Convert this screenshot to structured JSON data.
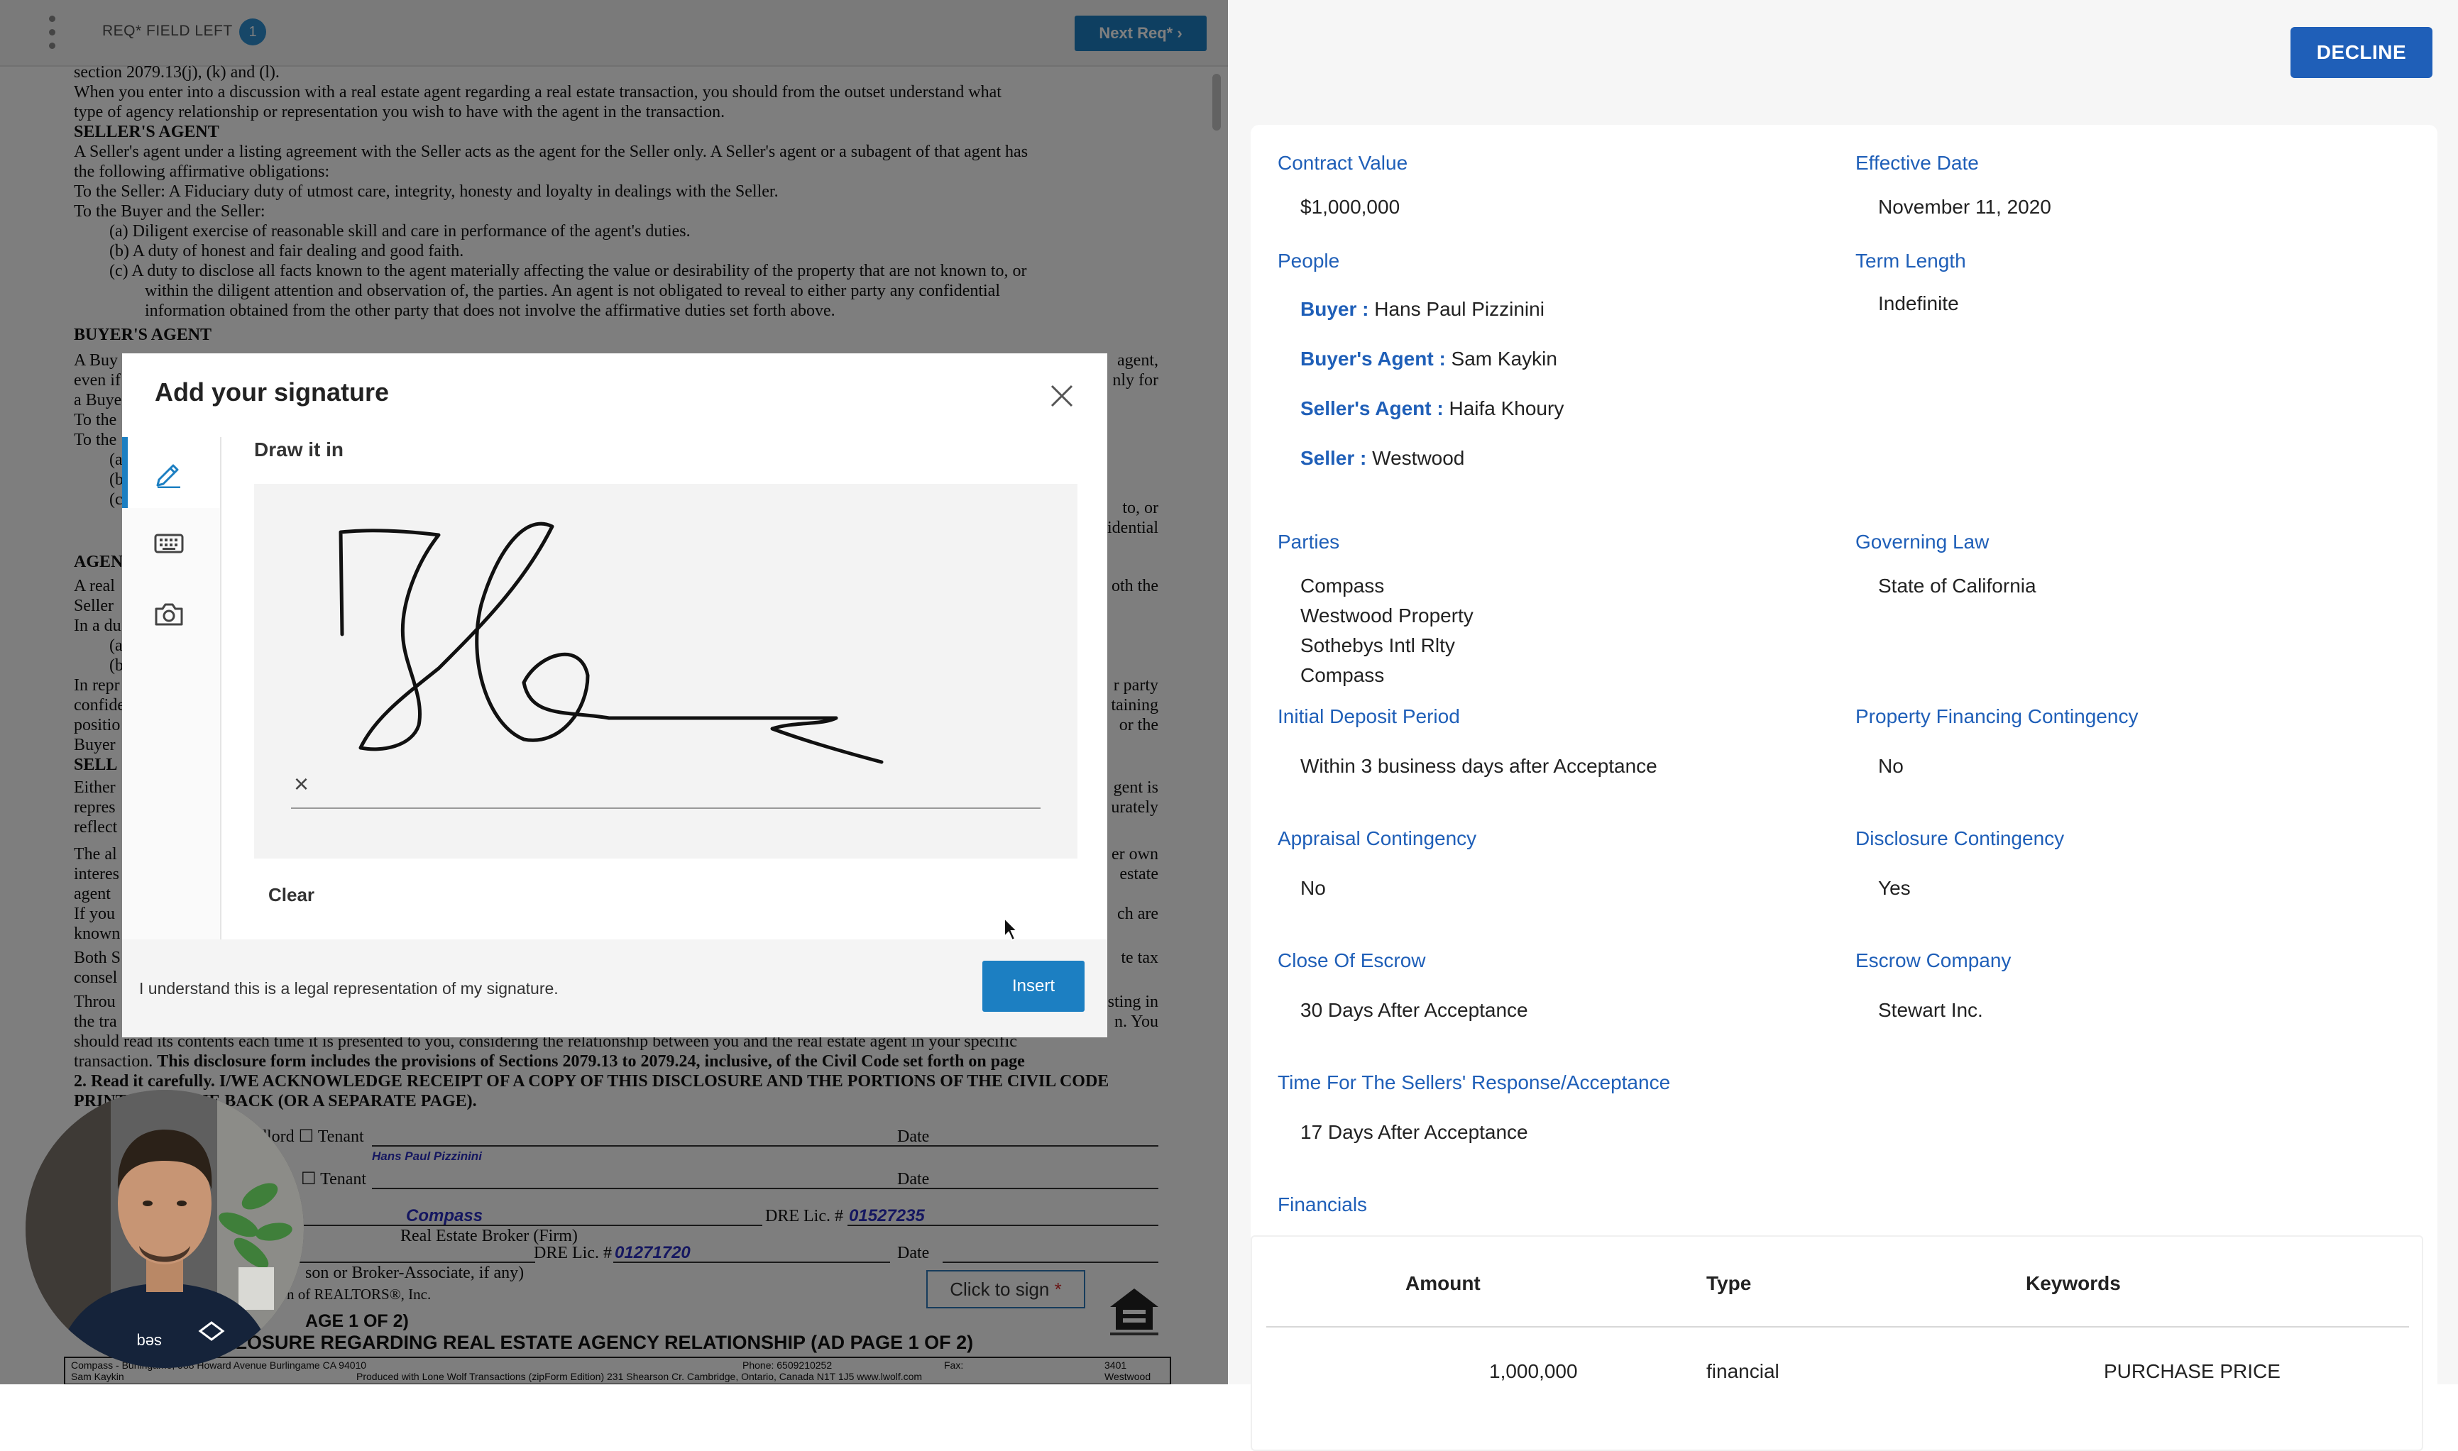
{
  "doc_toolbar": {
    "req_label": "REQ* FIELD LEFT",
    "req_count": "1",
    "next_req_label": "Next Req*",
    "next_req_icon": "chevron-right-icon"
  },
  "document": {
    "lines": {
      "l1": "section 2079.13(j), (k) and (l).",
      "l2": "When you enter into a discussion with a real estate agent regarding a real estate transaction, you should from the outset understand what",
      "l3": "type of agency relationship or representation you wish to have with the agent in the transaction.",
      "h_seller": "SELLER'S AGENT",
      "l4": "A Seller's agent under a listing agreement with the Seller acts as the agent for the Seller only. A Seller's agent or a subagent of that agent has",
      "l5": "the following affirmative obligations:",
      "l6": "To the Seller: A Fiduciary duty of utmost care, integrity, honesty and loyalty in dealings with the Seller.",
      "l7": "To the Buyer and the Seller:",
      "a": "(a)    Diligent exercise of reasonable skill and care in performance of the agent's duties.",
      "b": "(b)    A duty of honest and fair dealing and good faith.",
      "c1": "(c)    A duty to disclose all facts known to the agent materially affecting the value or desirability of the property that are not known to, or",
      "c2": "within the diligent attention and observation of, the parties. An agent is not obligated to reveal to either party any confidential",
      "c3": "information obtained from the other party that does not involve the affirmative duties set forth above.",
      "h_buyer": "BUYER'S AGENT",
      "b1": "A Buy",
      "b1r": "agent,",
      "b2": "even if",
      "b2r": "nly for",
      "b3": "a Buye",
      "b4": "To the",
      "b5": "To the",
      "b6": "(a",
      "b7": "(b",
      "b7r": "to, or",
      "b8": "(c",
      "b8r": "idential",
      "h_agent": "AGEN",
      "g1": "A real",
      "g1r": "oth the",
      "g2": "Seller",
      "g3": "In a du",
      "g4": "(a",
      "g5": "(b",
      "r1": "In repr",
      "r1r": "r party",
      "r2": "confide",
      "r2r": "taining",
      "r3": "positio",
      "r3r": "or the",
      "r4": "Buyer",
      "h_sell": "SELL",
      "s1": "Either",
      "s1r": "gent is",
      "s2": "repres",
      "s2r": "urately",
      "s3": "reflect",
      "t1": "The al",
      "t1r": "er own",
      "t2": "interes",
      "t2r": "estate",
      "t3": "agent",
      "u1": "If you",
      "u1r": "ch are",
      "u2": "known",
      "v1": "Both S",
      "v1r": "te tax",
      "v2": "consel",
      "w1": "Throu",
      "w1r": "sting in",
      "w2": "the tra",
      "w2r": "n. You",
      "w3": "should read its contents each time it is presented to you, considering the relationship between you and the real estate agent in your specific",
      "w4": "transaction.",
      "w4b": "This disclosure form includes the provisions of Sections 2079.13 to 2079.24, inclusive, of the Civil Code set forth on page",
      "w5": "2. Read it carefully. I/WE ACKNOWLEDGE RECEIPT OF A COPY OF THIS DISCLOSURE AND THE PORTIONS OF THE CIVIL CODE",
      "w6": "PRINTED ON THE BACK (OR A SEPARATE PAGE)."
    },
    "sign": {
      "landlord_frag": "dlord",
      "tenant_label": "Tenant",
      "date_label": "Date",
      "buyer_sig": "Hans Paul Pizzinini",
      "firm_name": "Compass",
      "dre_label": "DRE Lic. #",
      "dre_1": "01527235",
      "firm_caption": "Real Estate Broker (Firm)",
      "dre_2": "01271720",
      "assoc_caption": "son or Broker-Associate, if any)",
      "realtors_caption": "n of REALTORS®, Inc.",
      "page_caption": "AGE 1 OF 2)",
      "page_title": "CLOSURE REGARDING REAL ESTATE AGENCY RELATIONSHIP (AD PAGE 1 OF 2)",
      "click_to_sign": "Click to sign",
      "req_star": "*"
    },
    "footer": {
      "left": "Compass - Burlingame, 988 Howard Avenue Burlingame CA 94010",
      "phone": "Phone: 6509210252",
      "fax": "Fax:",
      "right": "3401 Westwood",
      "name": "Sam Kaykin",
      "produced": "Produced with Lone Wolf Transactions (zipForm Edition) 231 Shearson Cr. Cambridge, Ontario, Canada N1T 1J5   www.lwolf.com"
    }
  },
  "modal": {
    "title": "Add your signature",
    "close_icon": "close-icon",
    "tabs": [
      {
        "icon": "pen-icon",
        "active": true
      },
      {
        "icon": "keyboard-icon",
        "active": false
      },
      {
        "icon": "camera-icon",
        "active": false
      }
    ],
    "draw_label": "Draw it in",
    "baseline_mark": "×",
    "clear_label": "Clear",
    "legal_text": "I understand this is a legal representation of my signature.",
    "insert_label": "Insert"
  },
  "details": {
    "decline_label": "DECLINE",
    "contract_value": {
      "label": "Contract Value",
      "value": "$1,000,000"
    },
    "effective_date": {
      "label": "Effective Date",
      "value": "November 11, 2020"
    },
    "people": {
      "label": "People",
      "items": [
        {
          "role": "Buyer :",
          "name": " Hans Paul Pizzinini"
        },
        {
          "role": "Buyer's Agent :",
          "name": " Sam Kaykin"
        },
        {
          "role": "Seller's Agent :",
          "name": " Haifa Khoury"
        },
        {
          "role": "Seller :",
          "name": " Westwood"
        }
      ]
    },
    "term_length": {
      "label": "Term Length",
      "value": "Indefinite"
    },
    "parties": {
      "label": "Parties",
      "values": [
        "Compass",
        "Westwood Property",
        "Sothebys Intl Rlty",
        "Compass"
      ]
    },
    "governing_law": {
      "label": "Governing Law",
      "value": "State of California"
    },
    "initial_deposit": {
      "label": "Initial Deposit Period",
      "value": "Within 3 business days after Acceptance"
    },
    "financing_contingency": {
      "label": "Property Financing Contingency",
      "value": "No"
    },
    "appraisal_contingency": {
      "label": "Appraisal Contingency",
      "value": "No"
    },
    "disclosure_contingency": {
      "label": "Disclosure Contingency",
      "value": "Yes"
    },
    "close_of_escrow": {
      "label": "Close Of Escrow",
      "value": "30 Days After Acceptance"
    },
    "escrow_company": {
      "label": "Escrow Company",
      "value": "Stewart Inc."
    },
    "response_time": {
      "label": "Time For The Sellers' Response/Acceptance",
      "value": "17 Days After Acceptance"
    },
    "financials": {
      "label": "Financials",
      "columns": [
        "Amount",
        "Type",
        "Keywords"
      ],
      "rows": [
        {
          "amount": "1,000,000",
          "type": "financial",
          "keywords": "PURCHASE PRICE"
        }
      ]
    }
  },
  "colors": {
    "accent_blue": "#1f5fb8",
    "doc_button_blue": "#1c7fc2",
    "required_red": "#d32f2f"
  }
}
